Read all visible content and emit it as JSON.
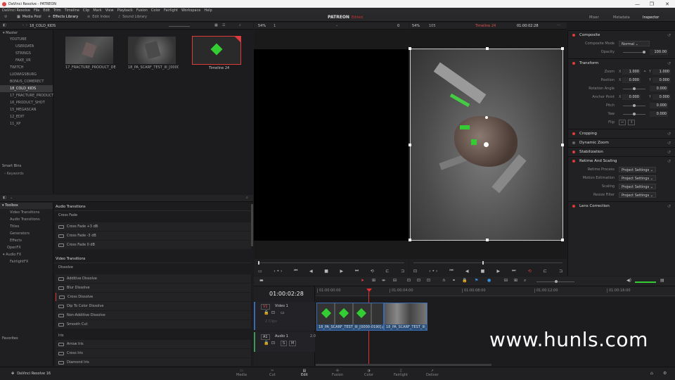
{
  "titlebar": {
    "title": "DaVinci Resolve - PATREON",
    "min": "—",
    "max": "❐",
    "close": "✕"
  },
  "menu": [
    "DaVinci Resolve",
    "File",
    "Edit",
    "Trim",
    "Timeline",
    "Clip",
    "Mark",
    "View",
    "Playback",
    "Fusion",
    "Color",
    "Fairlight",
    "Workspace",
    "Help"
  ],
  "toolbar": {
    "media_pool": "Media Pool",
    "effects_library": "Effects Library",
    "edit_index": "Edit Index",
    "sound_library": "Sound Library",
    "project": "PATREON",
    "edited": "Edited",
    "mixer": "Mixer",
    "metadata": "Metadata",
    "inspector": "Inspector"
  },
  "bins": {
    "current": "18_COLD_KIDS",
    "master": "Master",
    "items": [
      {
        "label": "YOUTUBE",
        "indent": 1
      },
      {
        "label": "USERDATA",
        "indent": 2
      },
      {
        "label": "STRINGS",
        "indent": 2
      },
      {
        "label": "FAKE_VR",
        "indent": 2
      },
      {
        "label": "TWITCH",
        "indent": 1
      },
      {
        "label": "LUDWIGSBURG",
        "indent": 1
      },
      {
        "label": "BONUS_COMERECT",
        "indent": 1
      },
      {
        "label": "18_COLD_KIDS",
        "indent": 1,
        "selected": true
      },
      {
        "label": "17_FRACTURE_PRODUCT",
        "indent": 1
      },
      {
        "label": "16_PRODUCT_SHOT",
        "indent": 1
      },
      {
        "label": "15_MEGASCAN",
        "indent": 1
      },
      {
        "label": "12_EDIT",
        "indent": 1
      },
      {
        "label": "11_XP",
        "indent": 1
      }
    ],
    "smart_bins": "Smart Bins",
    "keywords": "Keywords"
  },
  "media": [
    {
      "name": "17_FRACTURE_PRODUCT_DESIGN"
    },
    {
      "name": "18_PA_SCARF_TEST_III_[0000-0190].png"
    },
    {
      "name": "Timeline 24",
      "selected": true
    }
  ],
  "viewer_src": {
    "zoom": "54%",
    "num": "1",
    "tc": "0"
  },
  "viewer_tl": {
    "zoom": "54%",
    "fps": "105",
    "timeline": "Timeline 24",
    "tc": "01:00:02:28"
  },
  "toolbox": {
    "root": "Toolbox",
    "items": [
      "Video Transitions",
      "Audio Transitions",
      "Titles",
      "Generators",
      "Effects"
    ],
    "openfx": "OpenFX",
    "audiofx": "Audio FX",
    "fairlight": "FairlightFX",
    "favorites": "Favorites"
  },
  "effects": {
    "audio_header": "Audio Transitions",
    "cross_fade": "Cross Fade",
    "audio_items": [
      "Cross Fade +3 dB",
      "Cross Fade -3 dB",
      "Cross Fade 0 dB"
    ],
    "video_header": "Video Transitions",
    "dissolve": "Dissolve",
    "video_items": [
      "Additive Dissolve",
      "Blur Dissolve",
      "Cross Dissolve",
      "Dip To Color Dissolve",
      "Non-Additive Dissolve",
      "Smooth Cut"
    ],
    "iris": "Iris",
    "iris_items": [
      "Arrow Iris",
      "Cross Iris",
      "Diamond Iris"
    ]
  },
  "inspector": {
    "composite": "Composite",
    "composite_mode_label": "Composite Mode",
    "composite_mode": "Normal",
    "opacity_label": "Opacity",
    "opacity": "100.00",
    "transform": "Transform",
    "zoom_label": "Zoom",
    "zoom_x": "1.000",
    "zoom_y": "1.000",
    "position_label": "Position",
    "pos_x": "0.000",
    "pos_y": "0.000",
    "rotation_label": "Rotation Angle",
    "rotation": "0.000",
    "anchor_label": "Anchor Point",
    "anchor_x": "0.000",
    "anchor_y": "0.000",
    "pitch_label": "Pitch",
    "pitch": "0.000",
    "yaw_label": "Yaw",
    "yaw": "0.000",
    "flip_label": "Flip",
    "cropping": "Cropping",
    "dynamic_zoom": "Dynamic Zoom",
    "stabilization": "Stabilization",
    "retime": "Retime And Scaling",
    "retime_process_label": "Retime Process",
    "motion_est_label": "Motion Estimation",
    "scaling_label": "Scaling",
    "resize_filter_label": "Resize Filter",
    "project_settings": "Project Settings",
    "lens_correction": "Lens Correction"
  },
  "timeline": {
    "timecode": "01:00:02:28",
    "ruler": [
      "01:00:00:00",
      "01:00:04:00",
      "01:00:08:00",
      "01:00:12:00",
      "01:00:16:00"
    ],
    "video_track": "Video 1",
    "v_label": "V1",
    "clips_count": "2 Clips",
    "audio_track": "Audio 1",
    "a_label": "A1",
    "a_ch": "2.0",
    "clip1": "18_PA_SCARF_TEST_III_[0000-0190].png",
    "clip2": "18_PA_SCARF_TEST_III_[000..."
  },
  "pages": {
    "app": "DaVinci Resolve 16",
    "media": "Media",
    "cut": "Cut",
    "edit": "Edit",
    "fusion": "Fusion",
    "color": "Color",
    "fairlight": "Fairlight",
    "deliver": "Deliver"
  },
  "watermark": "www.hunls.com"
}
